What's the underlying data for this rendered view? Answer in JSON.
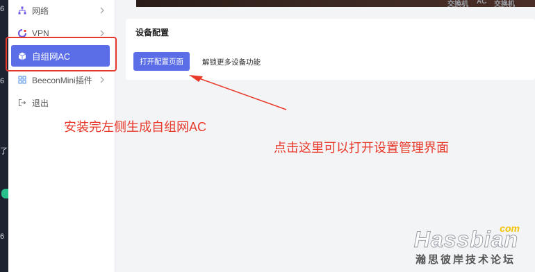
{
  "sidebar": {
    "items": [
      {
        "label": "网络",
        "icon": "network-icon"
      },
      {
        "label": "VPN",
        "icon": "vpn-icon"
      },
      {
        "label": "自组网AC",
        "icon": "cube-icon",
        "active": true
      },
      {
        "label": "BeeconMini插件",
        "icon": "grid-icon"
      },
      {
        "label": "退出",
        "icon": "logout-icon"
      }
    ]
  },
  "top_image": {
    "text1": "交换机",
    "text2": "AC",
    "text3": "交换机"
  },
  "left_fragments": [
    "6",
    "6",
    "了",
    "6"
  ],
  "card": {
    "title": "设备配置",
    "open_button": "打开配置页面",
    "unlock_link": "解锁更多设备功能"
  },
  "annotations": {
    "left_note": "安装完左侧生成自组网AC",
    "right_note": "点击这里可以打开设置管理界面"
  },
  "watermark": {
    "com": "com",
    "brand": "Hassbian",
    "subtitle": "瀚思彼岸技术论坛"
  },
  "colors": {
    "accent": "#5b6ee8",
    "annotation": "#e8392a",
    "watermark_com": "#f2c300"
  }
}
